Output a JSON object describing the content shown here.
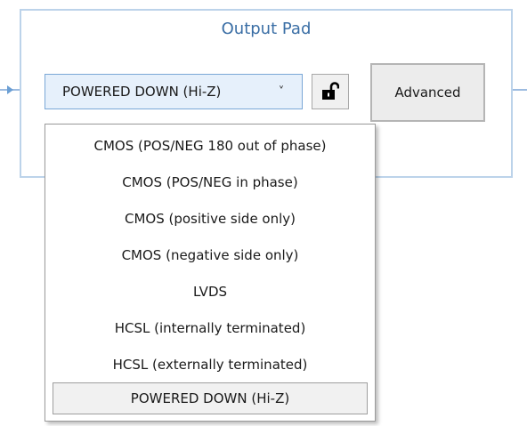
{
  "panel": {
    "title": "Output Pad"
  },
  "output_select": {
    "value": "POWERED DOWN (Hi-Z)",
    "chevron": "˅"
  },
  "lock_button": {
    "icon": "unlocked-padlock-icon"
  },
  "advanced_button": {
    "label": "Advanced"
  },
  "dropdown": {
    "options": [
      {
        "label": "CMOS (POS/NEG 180 out of phase)"
      },
      {
        "label": "CMOS (POS/NEG in phase)"
      },
      {
        "label": "CMOS (positive side only)"
      },
      {
        "label": "CMOS (negative side only)"
      },
      {
        "label": "LVDS"
      },
      {
        "label": "HCSL (internally terminated)"
      },
      {
        "label": "HCSL (externally terminated)"
      },
      {
        "label": "POWERED DOWN (Hi-Z)",
        "selected": true
      }
    ]
  },
  "colors": {
    "panel_border": "#bcd3ea",
    "title": "#3a6ea5",
    "select_bg": "#e6f0fb",
    "select_border": "#7aa7d6",
    "connector": "#9cbbe0"
  }
}
